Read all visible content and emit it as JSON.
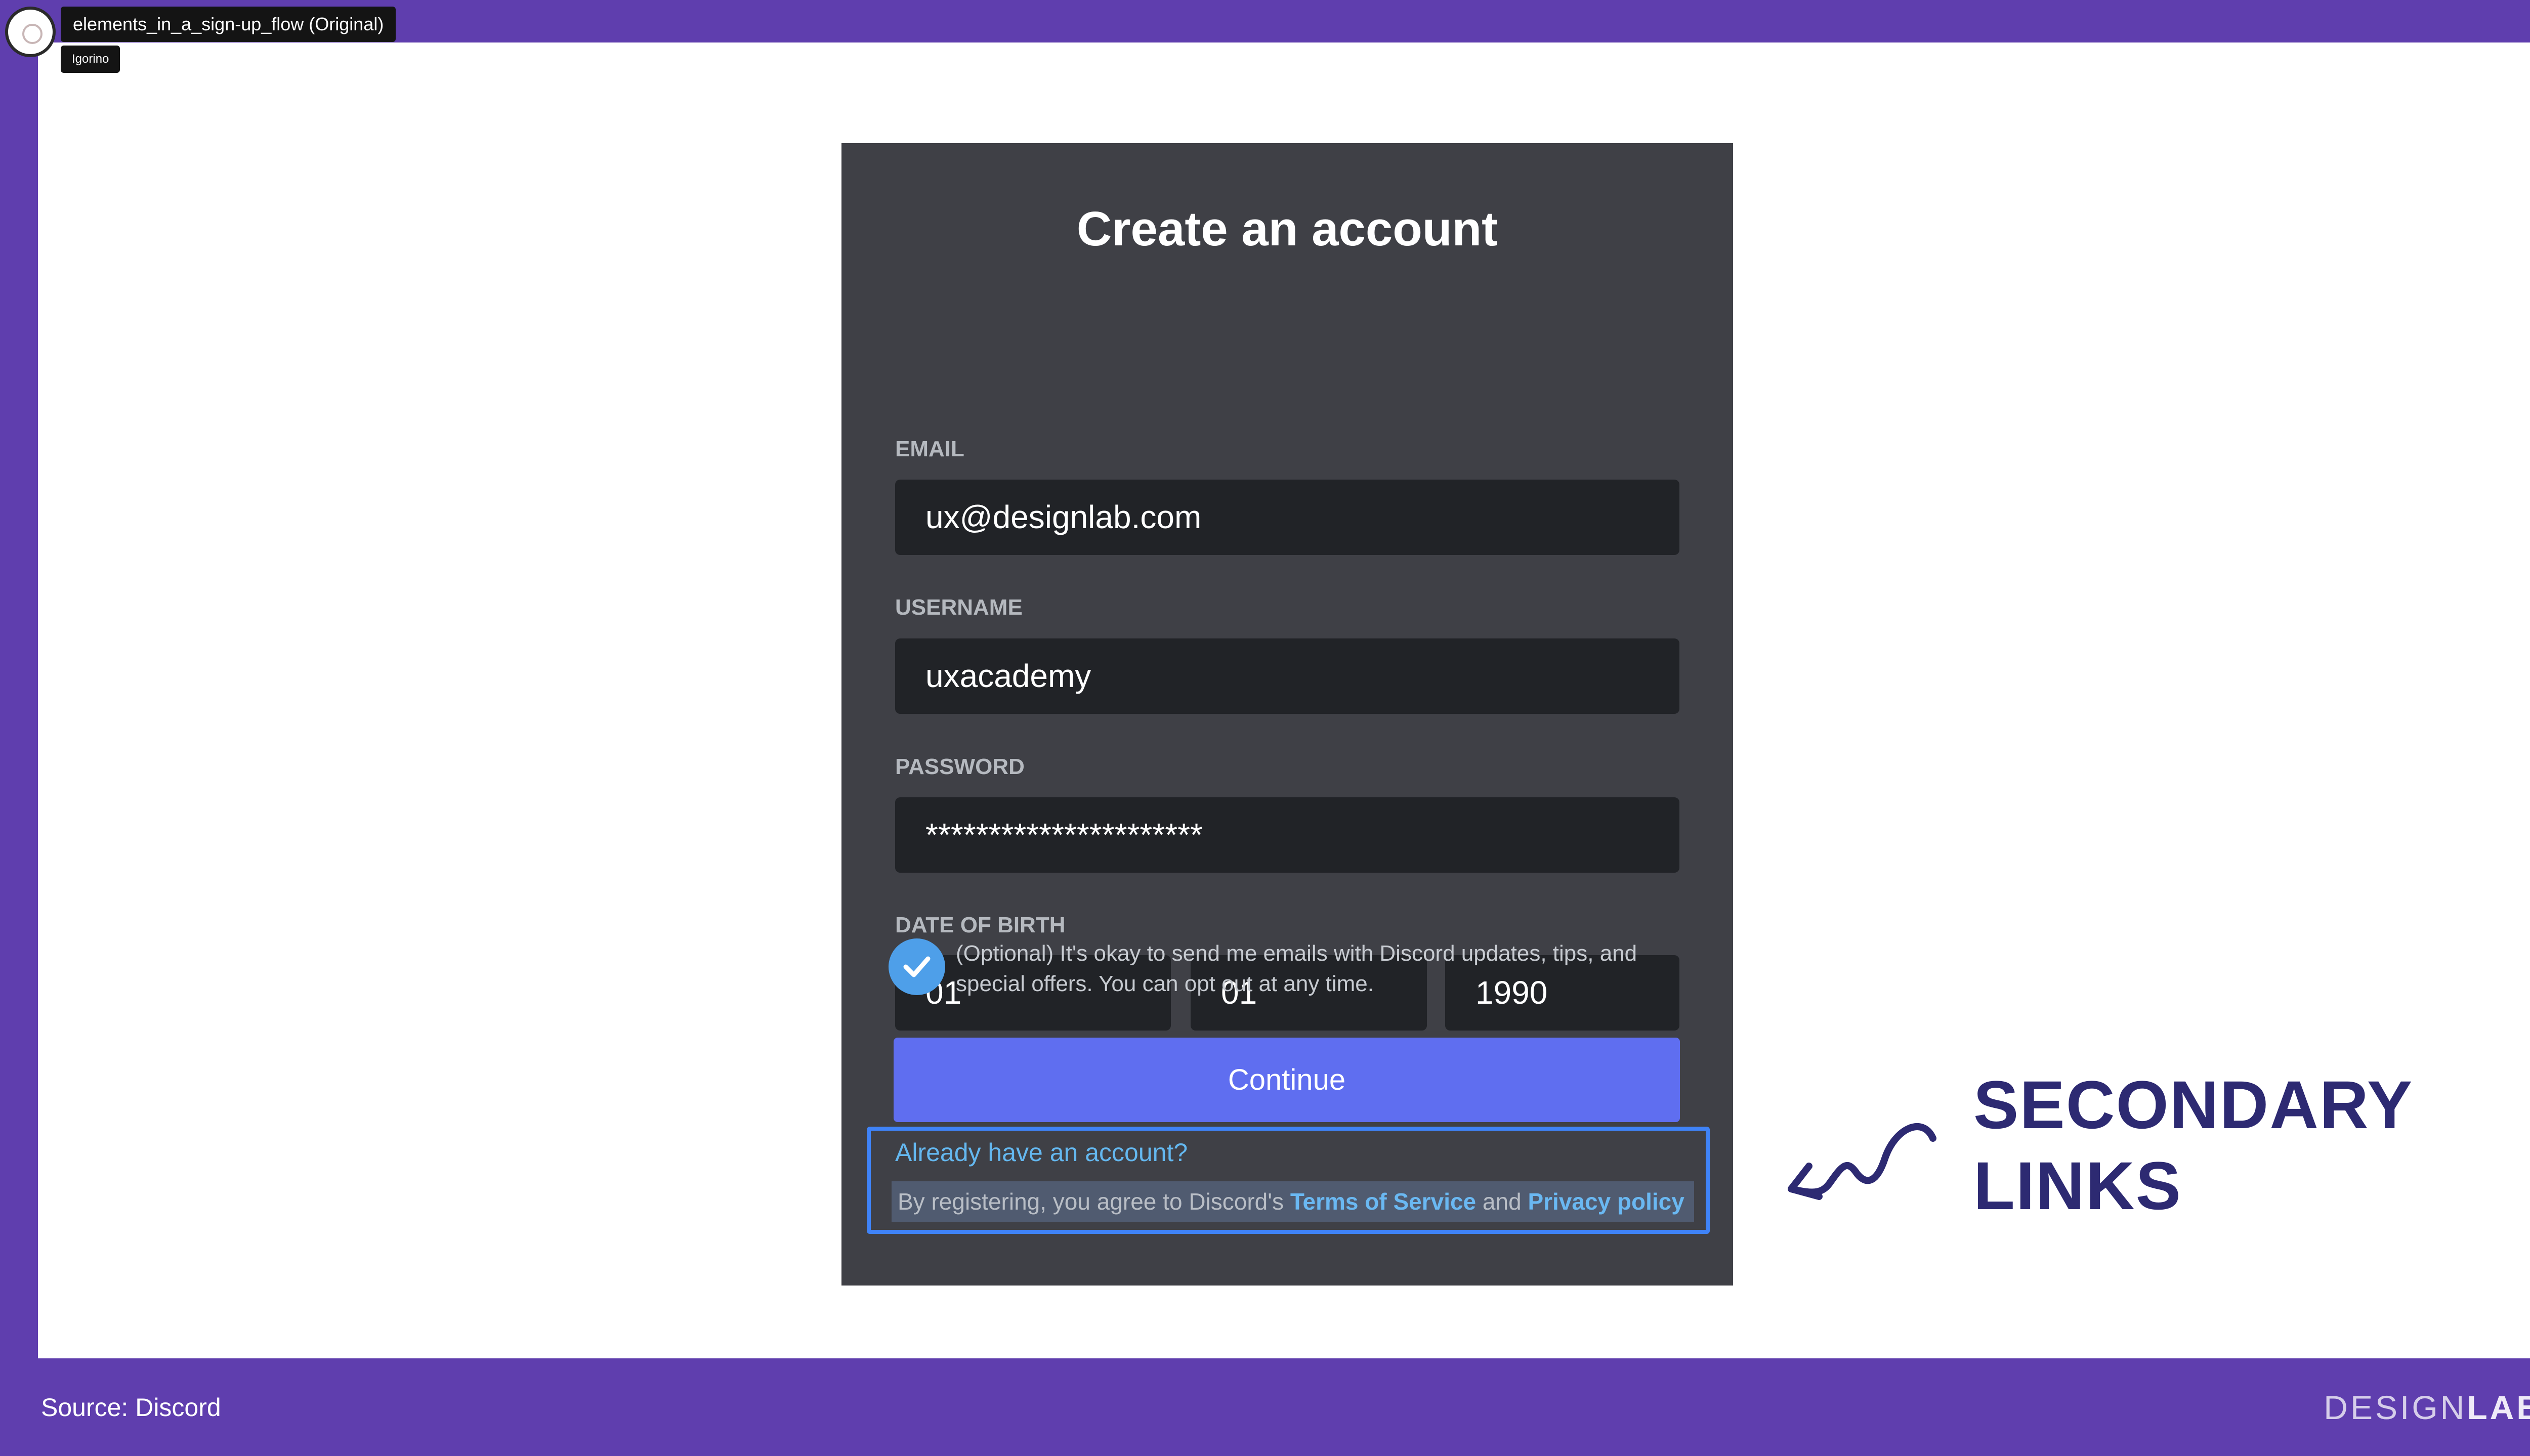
{
  "video": {
    "title": "elements_in_a_sign-up_flow (Original)",
    "author": "Igorino"
  },
  "form": {
    "title": "Create an account",
    "email_label": "EMAIL",
    "email_value": "ux@designlab.com",
    "username_label": "USERNAME",
    "username_value": "uxacademy",
    "password_label": "PASSWORD",
    "password_value": "**********************",
    "dob_label": "DATE OF BIRTH",
    "dob_month": "01",
    "dob_day": "01",
    "dob_year": "1990",
    "optin_checked": true,
    "optin_text": "(Optional) It's okay to send me emails with Discord updates, tips, and special offers. You can opt out at any time.",
    "continue_label": "Continue",
    "login_link": "Already have an account?",
    "terms_prefix": "By registering, you agree to Discord's",
    "terms_link": "Terms of Service",
    "terms_and": "and",
    "privacy_link": "Privacy policy"
  },
  "annotation": {
    "line1": "SECONDARY",
    "line2": "LINKS"
  },
  "footer": {
    "source": "Source: Discord",
    "brand_thin": "DESIGN",
    "brand_bold": "LAB"
  },
  "colors": {
    "frame": "#5f3eae",
    "card": "#3f4046",
    "field": "#212327",
    "button": "#5f6ef0",
    "checkbox": "#4e9fe9",
    "link": "#64b8f0",
    "highlight": "#3f83f8",
    "heading": "#2d2a72"
  },
  "icons": {
    "avatar": "avatar-icon",
    "check": "check-icon",
    "arrow": "curly-arrow-icon"
  }
}
